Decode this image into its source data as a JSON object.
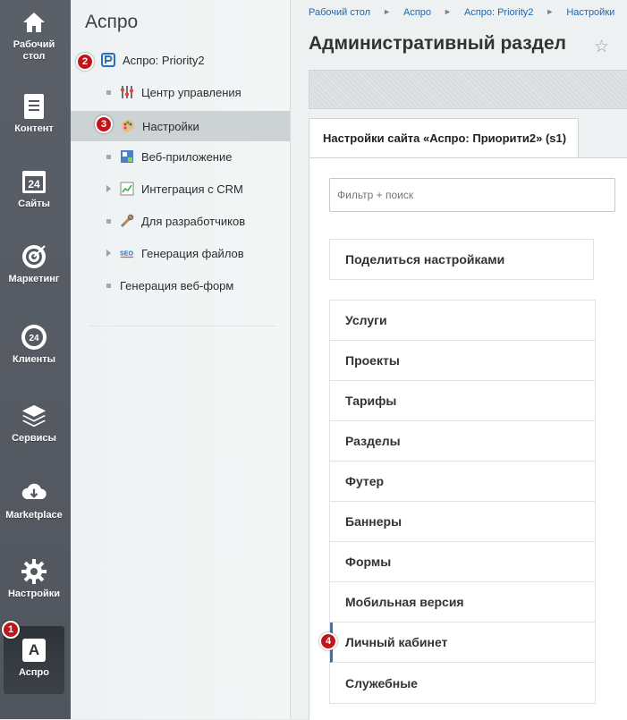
{
  "rail": {
    "items": [
      {
        "label": "Рабочий стол",
        "icon": "home-icon"
      },
      {
        "label": "Контент",
        "icon": "document-icon"
      },
      {
        "label": "Сайты",
        "icon": "calendar-24-icon"
      },
      {
        "label": "Маркетинг",
        "icon": "target-icon"
      },
      {
        "label": "Клиенты",
        "icon": "clients-24-icon"
      },
      {
        "label": "Сервисы",
        "icon": "layers-icon"
      },
      {
        "label": "Marketplace",
        "icon": "cloud-download-icon"
      },
      {
        "label": "Настройки",
        "icon": "gear-icon"
      },
      {
        "label": "Аспро",
        "icon": "aspro-logo-icon",
        "badge": "1"
      }
    ],
    "aspro_letter": "A"
  },
  "menu": {
    "title": "Аспро",
    "items": [
      {
        "label": "Аспро: Priority2",
        "badge": "2"
      },
      {
        "label": "Центр управления"
      },
      {
        "label": "Настройки",
        "badge": "3"
      },
      {
        "label": "Веб-приложение"
      },
      {
        "label": "Интеграция с CRM"
      },
      {
        "label": "Для разработчиков"
      },
      {
        "label": "Генерация файлов"
      },
      {
        "label": "Генерация веб-форм"
      }
    ]
  },
  "main": {
    "breadcrumb": [
      "Рабочий стол",
      "Аспро",
      "Аспро: Priority2",
      "Настройки"
    ],
    "breadcrumb_sep": "►",
    "title": "Административный раздел",
    "star": "☆",
    "tab_label": "Настройки сайта «Аспро: Приорити2» (s1)",
    "filter_placeholder": "Фильтр + поиск",
    "share_label": "Поделиться настройками",
    "sections": [
      "Услуги",
      "Проекты",
      "Тарифы",
      "Разделы",
      "Футер",
      "Баннеры",
      "Формы",
      "Мобильная версия",
      "Личный кабинет",
      "Служебные"
    ],
    "active_badge": "4"
  },
  "colors": {
    "rail": "#555a62",
    "badge": "#c2151b",
    "link": "#2067b0"
  }
}
